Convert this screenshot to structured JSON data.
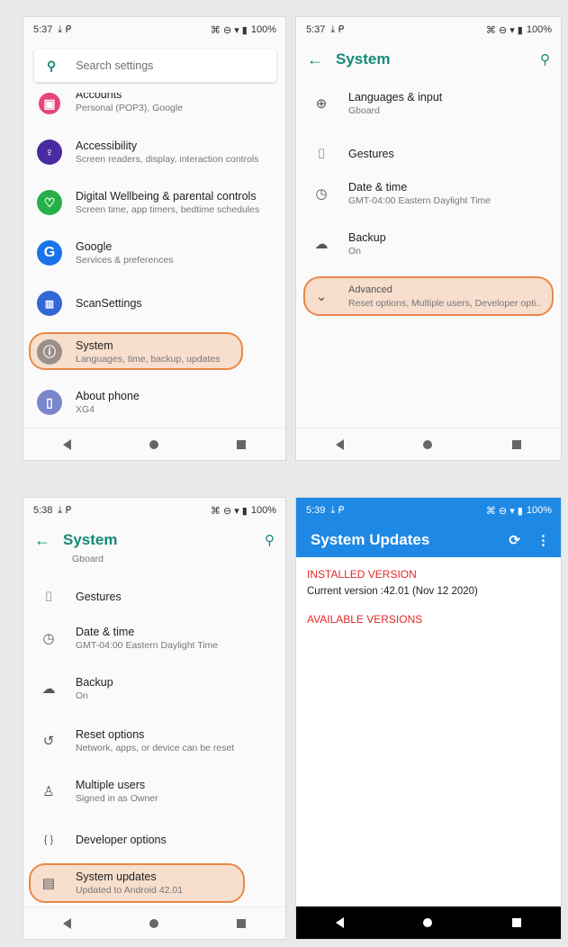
{
  "panel1": {
    "status": {
      "time": "5:37",
      "icons_left": "⤓ ᑭ",
      "battery": "100%"
    },
    "search_placeholder": "Search settings",
    "items": [
      {
        "title": "Accounts",
        "subtitle": "Personal (POP3), Google",
        "icon": "accounts-icon",
        "color": "#e8457a"
      },
      {
        "title": "Accessibility",
        "subtitle": "Screen readers, display, interaction controls",
        "icon": "accessibility-icon",
        "color": "#4a2aa0"
      },
      {
        "title": "Digital Wellbeing & parental controls",
        "subtitle": "Screen time, app timers, bedtime schedules",
        "icon": "wellbeing-icon",
        "color": "#27b04a"
      },
      {
        "title": "Google",
        "subtitle": "Services & preferences",
        "icon": "google-icon",
        "color": "#1a73e8"
      },
      {
        "title": "ScanSettings",
        "subtitle": "",
        "icon": "scan-icon",
        "color": "#3367d6"
      },
      {
        "title": "System",
        "subtitle": "Languages, time, backup, updates",
        "icon": "info-icon",
        "color": "#9a8f86"
      },
      {
        "title": "About phone",
        "subtitle": "XG4",
        "icon": "phone-icon",
        "color": "#7986cb"
      }
    ]
  },
  "panel2": {
    "status": {
      "time": "5:37",
      "icons_left": "⤓ ᑭ",
      "battery": "100%"
    },
    "title": "System",
    "items": [
      {
        "title": "Languages & input",
        "subtitle": "Gboard",
        "icon": "globe-icon"
      },
      {
        "title": "Gestures",
        "subtitle": "",
        "icon": "gestures-icon"
      },
      {
        "title": "Date & time",
        "subtitle": "GMT-04:00 Eastern Daylight Time",
        "icon": "clock-icon"
      },
      {
        "title": "Backup",
        "subtitle": "On",
        "icon": "backup-icon"
      },
      {
        "title": "Advanced",
        "subtitle": "Reset options, Multiple users, Developer opti..",
        "icon": "chevron-down-icon"
      }
    ]
  },
  "panel3": {
    "status": {
      "time": "5:38",
      "icons_left": "⤓ ᑭ",
      "battery": "100%"
    },
    "title": "System",
    "partial": "Gboard",
    "items": [
      {
        "title": "Gestures",
        "subtitle": "",
        "icon": "gestures-icon"
      },
      {
        "title": "Date & time",
        "subtitle": "GMT-04:00 Eastern Daylight Time",
        "icon": "clock-icon"
      },
      {
        "title": "Backup",
        "subtitle": "On",
        "icon": "backup-icon"
      },
      {
        "title": "Reset options",
        "subtitle": "Network, apps, or device can be reset",
        "icon": "reset-icon"
      },
      {
        "title": "Multiple users",
        "subtitle": "Signed in as Owner",
        "icon": "person-icon"
      },
      {
        "title": "Developer options",
        "subtitle": "",
        "icon": "braces-icon"
      },
      {
        "title": "System updates",
        "subtitle": "Updated to Android 42.01",
        "icon": "system-update-icon"
      }
    ]
  },
  "panel4": {
    "status": {
      "time": "5:39",
      "icons_left": "⤓ ᑭ",
      "battery": "100%"
    },
    "title": "System Updates",
    "installed_label": "INSTALLED VERSION",
    "current_version": "Current version :42.01 (Nov 12 2020)",
    "available_label": "AVAILABLE VERSIONS"
  },
  "glyphs": {
    "back": "←",
    "search": "⚲",
    "globe": "⊕",
    "gestures": "⌷",
    "clock": "◷",
    "backup": "☁",
    "chevron": "⌄",
    "reset": "↺",
    "person": "♙",
    "braces": "{ }",
    "sysupdate": "▤",
    "refresh": "⟳",
    "more": "⋮",
    "signal_icons": "⌘ ⊖ ▾ ▮"
  }
}
